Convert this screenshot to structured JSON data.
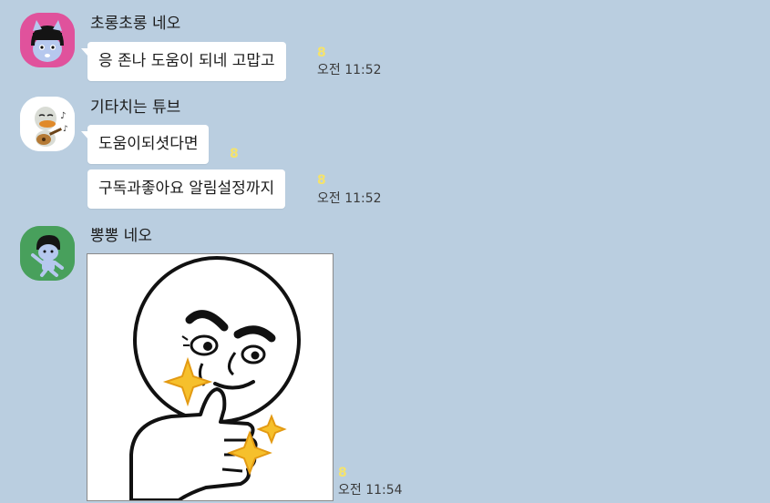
{
  "chat": {
    "background_color": "#bacee0",
    "messages": [
      {
        "sender": "초롱초롱 네오",
        "avatar_icon": "neo-character-icon",
        "avatar_color": "#e0529c",
        "bubbles": [
          {
            "text": "응 존나 도움이 되네 고맙고",
            "unread": "8",
            "time": "오전 11:52"
          }
        ]
      },
      {
        "sender": "기타치는 튜브",
        "avatar_icon": "tube-guitar-character-icon",
        "avatar_color": "#ffffff",
        "bubbles": [
          {
            "text": "도움이되셧다면",
            "unread": "8",
            "time": ""
          },
          {
            "text": "구독과좋아요 알림설정까지",
            "unread": "8",
            "time": "오전 11:52"
          }
        ]
      },
      {
        "sender": "뽕뽕 네오",
        "avatar_icon": "neo-dancing-character-icon",
        "avatar_color": "#48a05c",
        "sticker": {
          "icon": "thumbs-up-moon-sticker-icon",
          "unread": "8",
          "time": "오전 11:54"
        }
      }
    ]
  }
}
